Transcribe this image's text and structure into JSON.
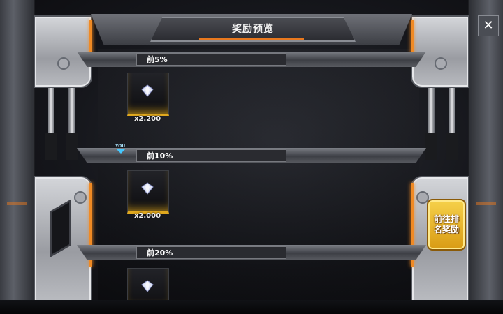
{
  "header": {
    "title": "奖励预览"
  },
  "close_button": {
    "label": "✕",
    "icon": "close-icon"
  },
  "you_marker": {
    "label": "YOU"
  },
  "tiers": [
    {
      "label": "前5%",
      "reward": {
        "icon": "diamond-icon",
        "quantity": "x2.200"
      }
    },
    {
      "label": "前10%",
      "reward": {
        "icon": "diamond-icon",
        "quantity": "x2.000"
      }
    },
    {
      "label": "前20%",
      "reward": {
        "icon": "diamond-icon",
        "quantity": ""
      }
    }
  ],
  "go_button": {
    "label": "前往排名奖励"
  },
  "colors": {
    "accent": "#f08a24",
    "gold": "#e0a81e",
    "marker": "#45c8ff"
  }
}
